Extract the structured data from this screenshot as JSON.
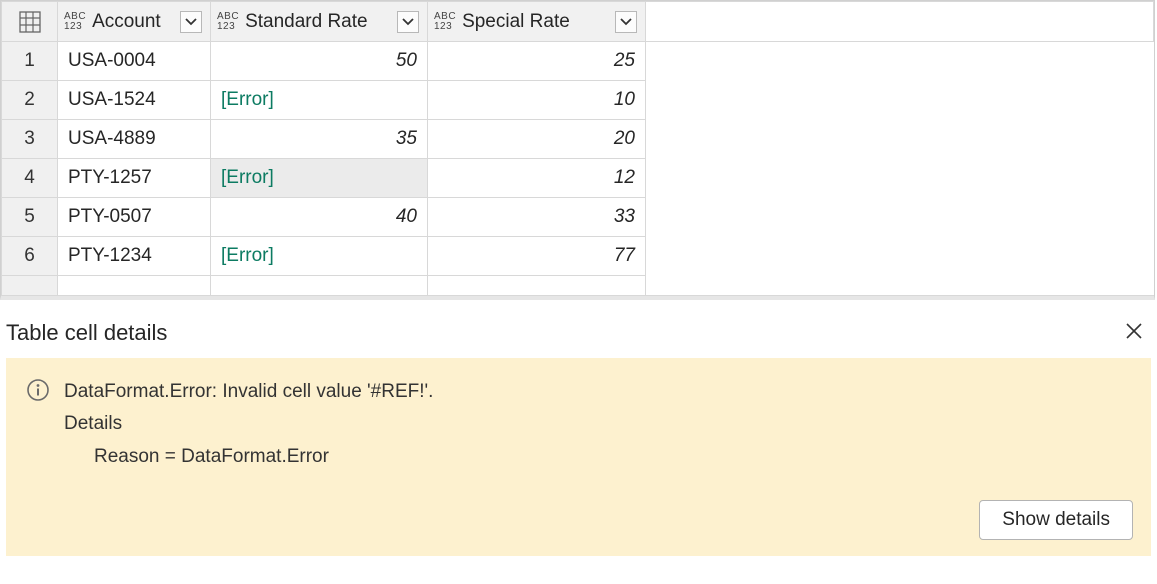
{
  "table": {
    "columns": [
      {
        "name": "Account"
      },
      {
        "name": "Standard Rate"
      },
      {
        "name": "Special Rate"
      }
    ],
    "rows": [
      {
        "num": "1",
        "account": "USA-0004",
        "standard": "50",
        "special": "25",
        "std_error": false
      },
      {
        "num": "2",
        "account": "USA-1524",
        "standard": "[Error]",
        "special": "10",
        "std_error": true
      },
      {
        "num": "3",
        "account": "USA-4889",
        "standard": "35",
        "special": "20",
        "std_error": false
      },
      {
        "num": "4",
        "account": "PTY-1257",
        "standard": "[Error]",
        "special": "12",
        "std_error": true,
        "selected": true
      },
      {
        "num": "5",
        "account": "PTY-0507",
        "standard": "40",
        "special": "33",
        "std_error": false
      },
      {
        "num": "6",
        "account": "PTY-1234",
        "standard": "[Error]",
        "special": "77",
        "std_error": true
      }
    ]
  },
  "details": {
    "title": "Table cell details",
    "error_line": "DataFormat.Error: Invalid cell value '#REF!'.",
    "details_label": "Details",
    "reason_line": "Reason = DataFormat.Error",
    "show_button": "Show details"
  },
  "type_label": {
    "top": "ABC",
    "bottom": "123"
  }
}
